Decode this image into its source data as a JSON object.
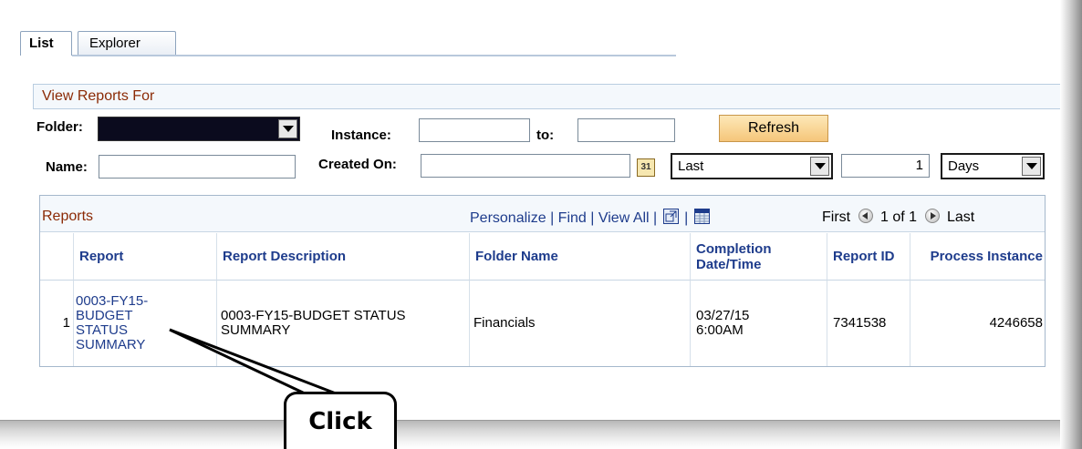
{
  "tabs": [
    {
      "label": "List"
    },
    {
      "label": "Explorer"
    }
  ],
  "filters": {
    "section_title": "View Reports For",
    "folder_label": "Folder:",
    "instance_label": "Instance:",
    "instance_value": "",
    "to_label": "to:",
    "to_value": "",
    "refresh_label": "Refresh",
    "name_label": "Name:",
    "name_value": "",
    "created_on_label": "Created On:",
    "created_on_value": "",
    "range_select": "Last",
    "range_value": "1",
    "unit_select": "Days"
  },
  "grid": {
    "title": "Reports",
    "links": {
      "personalize": "Personalize",
      "sep1": "|",
      "find": "Find",
      "sep2": "|",
      "view_all": "View All",
      "sep3": "|",
      "sep4": "|"
    },
    "pager": {
      "first": "First",
      "count": "1 of 1",
      "last": "Last"
    },
    "columns": [
      "Report",
      "Report Description",
      "Folder Name",
      "Completion Date/Time",
      "Report ID",
      "Process Instance"
    ],
    "rows": [
      {
        "num": "1",
        "report": "0003-FY15-BUDGET STATUS SUMMARY",
        "description": "0003-FY15-BUDGET STATUS SUMMARY",
        "folder": "Financials",
        "completion": "03/27/15 6:00AM",
        "report_id": "7341538",
        "process_instance": "4246658"
      }
    ]
  },
  "callout": {
    "text": "Click"
  },
  "icons": [
    "dropdown-arrow-icon",
    "calendar-icon",
    "new-window-icon",
    "spreadsheet-icon",
    "first-arrow-icon",
    "last-arrow-icon"
  ],
  "colors": {
    "section_title": "#8b2a05",
    "link": "#1e3c8c",
    "refresh_button": "#f5c67a",
    "folder_select": "#0b0b1e"
  }
}
